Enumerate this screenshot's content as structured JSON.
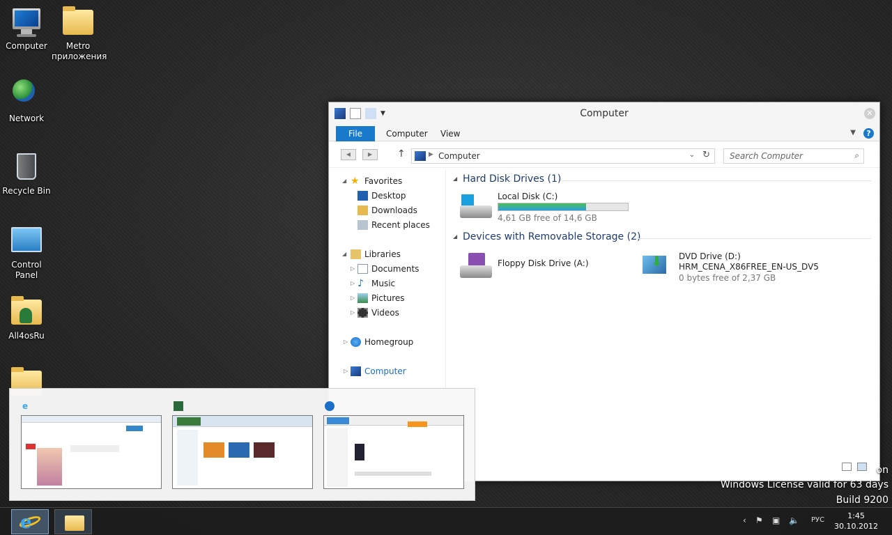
{
  "desktop": {
    "icons": [
      {
        "label": "Computer"
      },
      {
        "label": "Metro\nприложения"
      },
      {
        "label": "Network"
      },
      {
        "label": "Recycle Bin"
      },
      {
        "label": "Control\nPanel"
      },
      {
        "label": "All4osRu"
      }
    ]
  },
  "explorer": {
    "title": "Computer",
    "ribbon_tabs": [
      "File",
      "Computer",
      "View"
    ],
    "address": "Computer",
    "search_placeholder": "Search Computer",
    "nav": {
      "favorites": "Favorites",
      "desktop": "Desktop",
      "downloads": "Downloads",
      "recent": "Recent places",
      "libraries": "Libraries",
      "documents": "Documents",
      "music": "Music",
      "pictures": "Pictures",
      "videos": "Videos",
      "homegroup": "Homegroup",
      "computer": "Computer"
    },
    "groups": {
      "hdd": "Hard Disk Drives (1)",
      "removable": "Devices with Removable Storage (2)"
    },
    "drives": {
      "local": {
        "name": "Local Disk (C:)",
        "free": "4,61 GB free of 14,6 GB",
        "used_fraction": 0.68
      },
      "floppy": {
        "name": "Floppy Disk Drive (A:)"
      },
      "dvd": {
        "name": "DVD Drive (D:)",
        "label": "HRM_CENA_X86FREE_EN-US_DV5",
        "free": "0 bytes free of 2,37 GB"
      }
    }
  },
  "watermark": {
    "line1": "on",
    "line2": "Windows License valid for 63 days",
    "line3": "Build 9200"
  },
  "taskbar": {
    "lang": "РУС",
    "time": "1:45",
    "date": "30.10.2012"
  },
  "colors": {
    "accent": "#1979ca",
    "disk_bar": "#26a0da"
  }
}
